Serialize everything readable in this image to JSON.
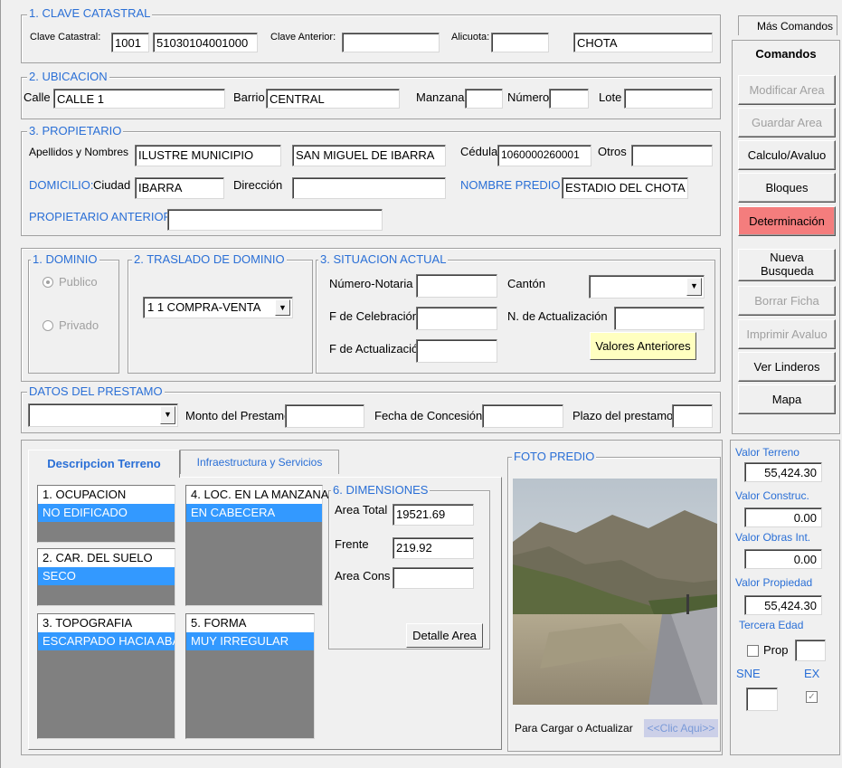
{
  "clave": {
    "title": "1. CLAVE CATASTRAL",
    "clave_label": "Clave Catastral:",
    "clave_part1": "1001",
    "clave_part2": "51030104001000",
    "anterior_label": "Clave Anterior:",
    "anterior_value": "",
    "alicuota_label": "Alicuota:",
    "alicuota_value": "",
    "sector_value": "CHOTA"
  },
  "ubicacion": {
    "title": "2. UBICACION",
    "calle_label": "Calle",
    "calle_value": "CALLE 1",
    "barrio_label": "Barrio",
    "barrio_value": "CENTRAL",
    "manzana_label": "Manzana",
    "manzana_value": "",
    "numero_label": "Número",
    "numero_value": "",
    "lote_label": "Lote",
    "lote_value": ""
  },
  "propietario": {
    "title": "3. PROPIETARIO",
    "nombres_label": "Apellidos y Nombres",
    "apellidos_value": "ILUSTRE MUNICIPIO",
    "nombres_value": "SAN MIGUEL DE IBARRA",
    "cedula_label": "Cédula",
    "cedula_value": "1060000260001",
    "otros_label": "Otros",
    "otros_value": "",
    "domicilio_label": "DOMICILIO:",
    "ciudad_label": "Ciudad",
    "ciudad_value": "IBARRA",
    "direccion_label": "Dirección",
    "direccion_value": "",
    "nombre_predio_label": "NOMBRE PREDIO",
    "nombre_predio_value": "ESTADIO DEL CHOTA",
    "anterior_label": "PROPIETARIO ANTERIOR:",
    "anterior_value": ""
  },
  "dominio": {
    "title": "1. DOMINIO",
    "publico_label": "Publico",
    "privado_label": "Privado",
    "selected": "Publico"
  },
  "traslado": {
    "title": "2. TRASLADO DE DOMINIO",
    "value": "1 1 COMPRA-VENTA"
  },
  "situacion": {
    "title": "3. SITUACION ACTUAL",
    "notaria_label": "Número-Notaria",
    "notaria_value": "",
    "celebracion_label": "F de Celebración",
    "celebracion_value": "",
    "actualizacion_label": "F de Actualización",
    "actualizacion_value": "",
    "canton_label": "Cantón",
    "canton_value": "",
    "n_actualizacion_label": "N. de Actualización",
    "n_actualizacion_value": "",
    "valores_button": "Valores Anteriores"
  },
  "prestamo": {
    "title": "DATOS DEL PRESTAMO",
    "tipo_value": "",
    "monto_label": "Monto del Prestamo",
    "monto_value": "",
    "fecha_label": "Fecha de Concesión",
    "fecha_value": "",
    "plazo_label": "Plazo del prestamo",
    "plazo_value": ""
  },
  "tabs": [
    {
      "label": "Descripcion Terreno",
      "active": true
    },
    {
      "label": "Infraestructura y Servicios",
      "active": false
    }
  ],
  "terreno": {
    "ocupacion": {
      "header": "1. OCUPACION",
      "selected": "NO EDIFICADO"
    },
    "suelo": {
      "header": "2. CAR. DEL SUELO",
      "selected": "SECO"
    },
    "topografia": {
      "header": "3. TOPOGRAFIA",
      "selected": "ESCARPADO HACIA ABA"
    },
    "manzana": {
      "header": "4. LOC. EN LA MANZANA",
      "selected": "EN CABECERA"
    },
    "forma": {
      "header": "5. FORMA",
      "selected": "MUY IRREGULAR"
    }
  },
  "dimensiones": {
    "title": "6. DIMENSIONES",
    "area_total_label": "Area Total",
    "area_total_value": "19521.69",
    "frente_label": "Frente",
    "frente_value": "219.92",
    "area_cons_label": "Area Cons",
    "area_cons_value": "",
    "detalle_button": "Detalle Area"
  },
  "foto": {
    "title": "FOTO PREDIO",
    "cargar_label": "Para Cargar o Actualizar",
    "clic_label": "<<Clic Aqui>>"
  },
  "comandos": {
    "tab_mas": "Más Comandos",
    "tab_comandos": "Comandos",
    "buttons": [
      {
        "label": "Modificar Area",
        "state": "disabled"
      },
      {
        "label": "Guardar Area",
        "state": "disabled"
      },
      {
        "label": "Calculo/Avaluo",
        "state": "enabled"
      },
      {
        "label": "Bloques",
        "state": "enabled"
      },
      {
        "label": "Determinación",
        "state": "highlighted"
      },
      {
        "label": "Nueva Busqueda",
        "state": "enabled"
      },
      {
        "label": "Borrar Ficha",
        "state": "disabled"
      },
      {
        "label": "Imprimir Avaluo",
        "state": "disabled"
      },
      {
        "label": "Ver Linderos",
        "state": "enabled"
      },
      {
        "label": "Mapa",
        "state": "enabled"
      }
    ]
  },
  "valores": {
    "terreno_label": "Valor Terreno",
    "terreno_value": "55,424.30",
    "construc_label": "Valor Construc.",
    "construc_value": "0.00",
    "obras_label": "Valor Obras Int.",
    "obras_value": "0.00",
    "propiedad_label": "Valor Propiedad",
    "propiedad_value": "55,424.30",
    "tercera_label": "Tercera Edad",
    "prop_label": "Prop",
    "prop_checked": false,
    "prop_value": "",
    "sne_label": "SNE",
    "ex_label": "EX",
    "sne_value": "",
    "ex_checked": true
  },
  "colors": {
    "accent_blue": "#2a6fd6",
    "selection_blue": "#3399ff",
    "highlight_red": "#f47d7d",
    "tooltip_yellow": "#ffffc0"
  }
}
